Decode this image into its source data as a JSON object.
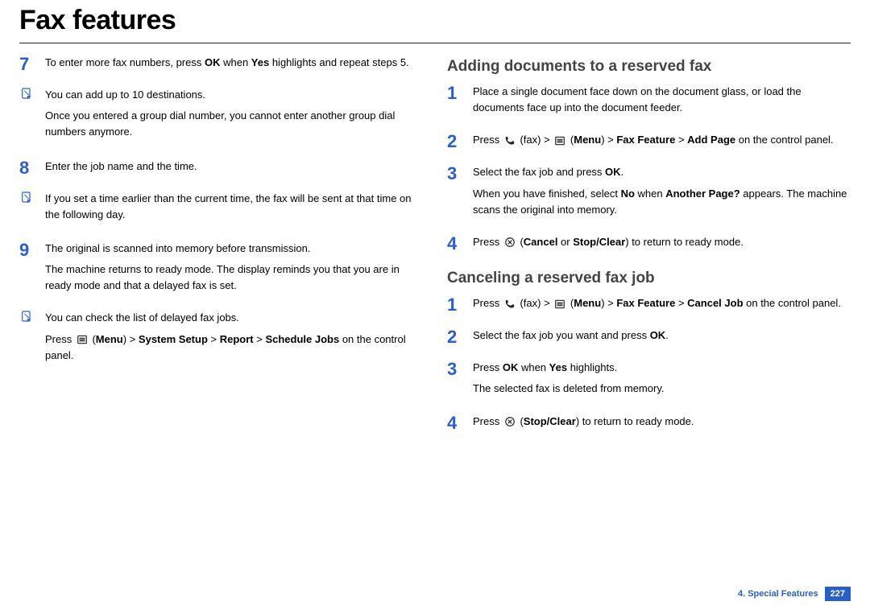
{
  "title": "Fax features",
  "left": {
    "step7": {
      "p1a": "To enter more fax numbers, press ",
      "p1b": "OK",
      "p1c": " when ",
      "p1d": "Yes",
      "p1e": " highlights and repeat steps 5."
    },
    "note1": {
      "p1": "You can add up to 10 destinations.",
      "p2": "Once you entered a group dial number, you cannot enter another group dial numbers anymore."
    },
    "step8": {
      "p1": "Enter the job name and the time."
    },
    "note2": {
      "p1": "If you set a time earlier than the current time, the fax will be sent at that time on the following day."
    },
    "step9": {
      "p1": "The original is scanned into memory before transmission.",
      "p2": "The machine returns to ready mode. The display reminds you that you are in ready mode and that a delayed fax is set."
    },
    "note3": {
      "p1": "You can check the list of delayed fax jobs.",
      "p2a": "Press ",
      "p2b": "Menu",
      "p2c": " > ",
      "p2d": "System Setup",
      "p2e": " > ",
      "p2f": "Report",
      "p2g": " > ",
      "p2h": "Schedule Jobs",
      "p2i": " on the control panel."
    }
  },
  "right": {
    "h_add": "Adding documents to a reserved fax",
    "add1": {
      "p1": "Place a single document face down on the document glass, or load the documents face up into the document feeder."
    },
    "add2": {
      "a": "Press ",
      "b": " (fax) > ",
      "c": " (",
      "d": "Menu",
      "e": ") > ",
      "f": "Fax Feature",
      "g": " > ",
      "h": "Add Page",
      "i": " on the control panel."
    },
    "add3": {
      "p1a": "Select the fax job and press ",
      "p1b": "OK",
      "p1c": ".",
      "p2a": "When you have finished, select ",
      "p2b": "No",
      "p2c": " when ",
      "p2d": "Another Page?",
      "p2e": " appears. The machine scans the original into memory."
    },
    "add4": {
      "a": "Press ",
      "b": " (",
      "c": "Cancel",
      "d": " or ",
      "e": "Stop/Clear",
      "f": ") to return to ready mode."
    },
    "h_cancel": "Canceling a reserved fax job",
    "can1": {
      "a": "Press ",
      "b": " (fax) > ",
      "c": " (",
      "d": "Menu",
      "e": ") > ",
      "f": "Fax Feature",
      "g": " > ",
      "h": "Cancel Job",
      "i": " on the control panel."
    },
    "can2": {
      "a": "Select the fax job you want and press ",
      "b": "OK",
      "c": "."
    },
    "can3": {
      "p1a": "Press ",
      "p1b": "OK",
      "p1c": " when ",
      "p1d": "Yes",
      "p1e": " highlights.",
      "p2": "The selected fax is deleted from memory."
    },
    "can4": {
      "a": "Press ",
      "b": " (",
      "c": "Stop/Clear",
      "d": ") to return to ready mode."
    }
  },
  "footer": {
    "chapter": "4.  Special Features",
    "page": "227"
  },
  "nums": {
    "n1": "1",
    "n2": "2",
    "n3": "3",
    "n4": "4",
    "n7": "7",
    "n8": "8",
    "n9": "9"
  }
}
